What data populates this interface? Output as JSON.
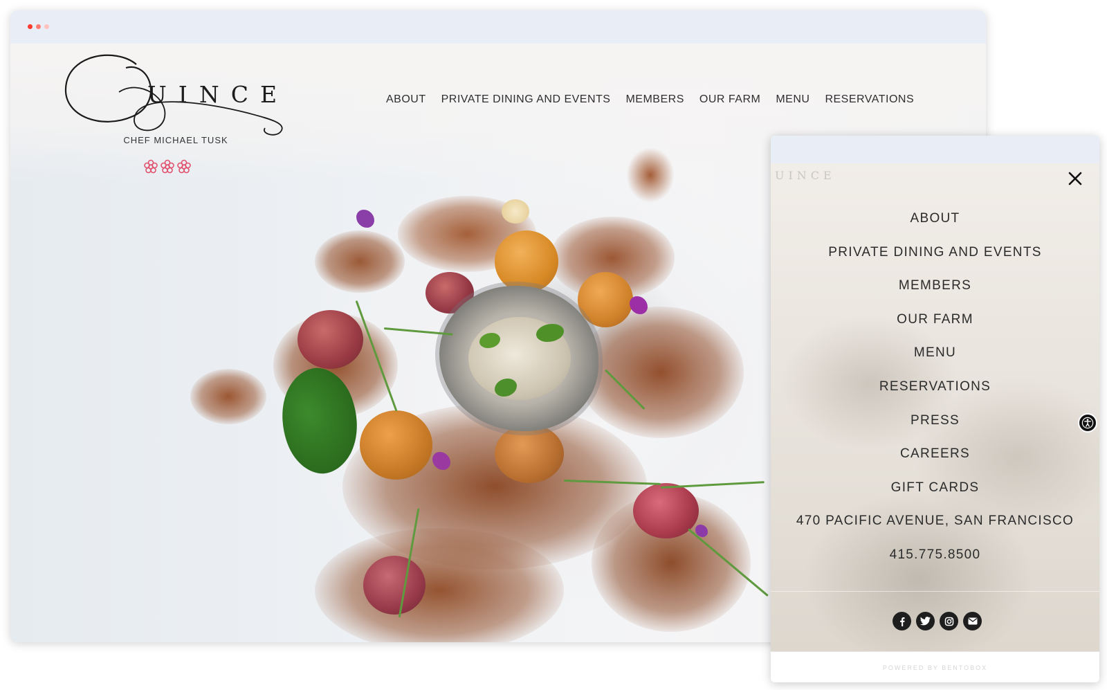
{
  "brand": {
    "name": "UINCE",
    "subtitle": "CHEF MICHAEL TUSK",
    "michelin_stars": 3,
    "star_color": "#e0516e"
  },
  "desktop_nav": [
    {
      "label": "ABOUT"
    },
    {
      "label": "PRIVATE DINING AND EVENTS"
    },
    {
      "label": "MEMBERS"
    },
    {
      "label": "OUR FARM"
    },
    {
      "label": "MENU"
    },
    {
      "label": "RESERVATIONS"
    }
  ],
  "mobile_menu": {
    "brand_faded": "UINCE",
    "items": [
      {
        "label": "ABOUT"
      },
      {
        "label": "PRIVATE DINING AND EVENTS"
      },
      {
        "label": "MEMBERS"
      },
      {
        "label": "OUR FARM"
      },
      {
        "label": "MENU"
      },
      {
        "label": "RESERVATIONS"
      },
      {
        "label": "PRESS"
      },
      {
        "label": "CAREERS"
      },
      {
        "label": "GIFT CARDS"
      },
      {
        "label": "470 PACIFIC AVENUE, SAN FRANCISCO"
      },
      {
        "label": "415.775.8500"
      }
    ],
    "close_icon": "close-icon",
    "social_icons": [
      "facebook-icon",
      "twitter-icon",
      "instagram-icon",
      "email-icon"
    ],
    "footer": "POWERED BY BENTOBOX"
  },
  "accessibility_icon": "accessibility-icon",
  "colors": {
    "chrome_dot_1": "#ff5f57",
    "chrome_dot_2": "#ff7b72",
    "chrome_dot_3": "#ffc2be",
    "text": "#2b2b2b"
  }
}
